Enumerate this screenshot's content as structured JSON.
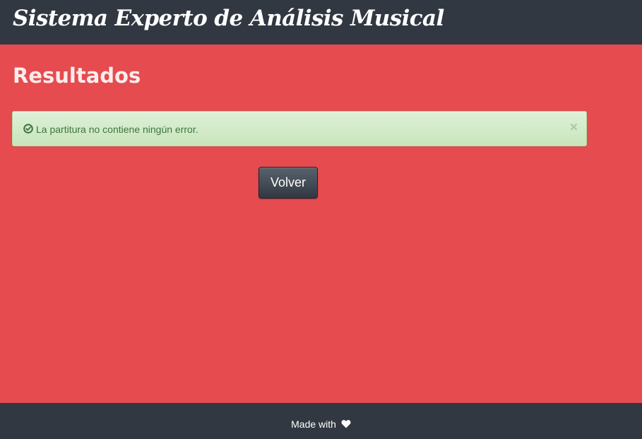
{
  "header": {
    "brand": "Sistema Experto de Análisis Musical"
  },
  "main": {
    "title": "Resultados",
    "alert": {
      "icon": "check-circle-icon",
      "message": "La partitura no contiene ningún error.",
      "close": "×"
    },
    "back_button": "Volver"
  },
  "footer": {
    "text": "Made with",
    "icon": "heart-icon"
  },
  "colors": {
    "background": "#e54b4f",
    "navbar": "#313842",
    "alert_text": "#3c763d",
    "alert_bg": "#dff0d8"
  }
}
